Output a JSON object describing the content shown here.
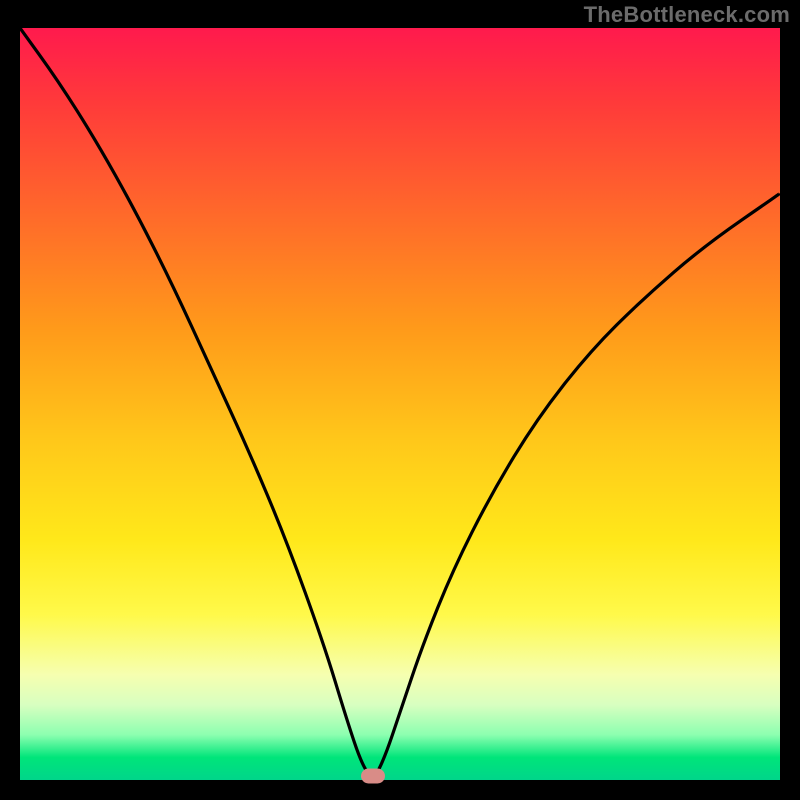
{
  "watermark": "TheBottleneck.com",
  "chart_data": {
    "type": "line",
    "title": "",
    "xlabel": "",
    "ylabel": "",
    "xlim": [
      0,
      100
    ],
    "ylim": [
      0,
      100
    ],
    "series": [
      {
        "name": "curve",
        "x": [
          0,
          5,
          10,
          15,
          20,
          25,
          30,
          35,
          40,
          43,
          45,
          46.5,
          48,
          50,
          53,
          57,
          62,
          68,
          75,
          82,
          90,
          100
        ],
        "values": [
          100,
          93,
          85,
          76,
          66,
          55,
          44,
          32,
          18,
          8,
          2,
          0,
          3,
          9,
          18,
          28,
          38,
          48,
          57,
          64,
          71,
          78
        ]
      }
    ],
    "marker": {
      "x": 46.5,
      "y": 0
    },
    "background_gradient": {
      "top": "#ff1a4d",
      "mid": "#ffe81a",
      "bottom": "#00d58a"
    },
    "colors": {
      "curve": "#000000",
      "marker": "#d98c87",
      "frame": "#000000",
      "watermark": "#6b6b6b"
    }
  }
}
